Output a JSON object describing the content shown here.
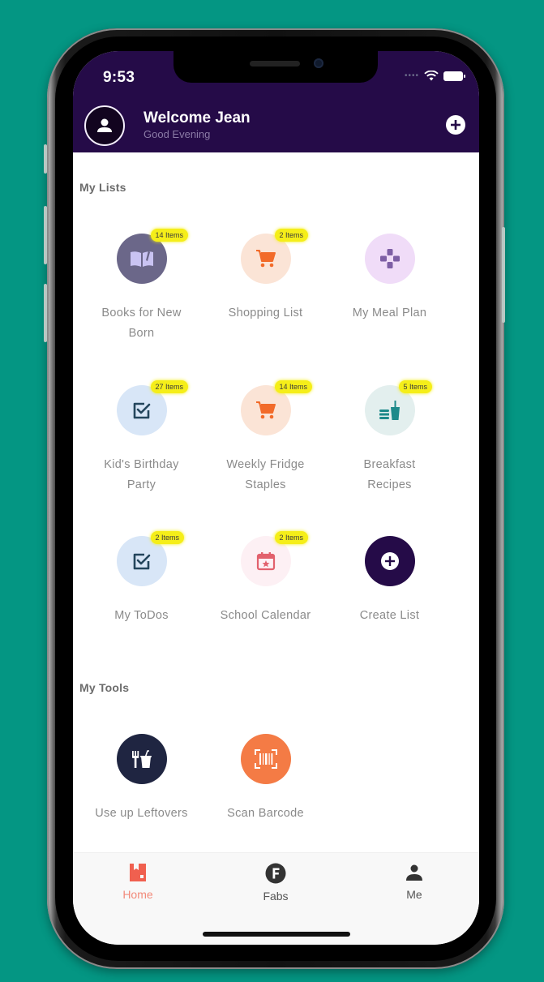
{
  "status_bar": {
    "time": "9:53",
    "signal_icon": "signal-dots-icon",
    "wifi_icon": "wifi-icon",
    "battery_icon": "battery-icon"
  },
  "header": {
    "avatar_icon": "user-icon",
    "title": "Welcome Jean",
    "subtitle": "Good Evening",
    "add_icon": "plus-circle-icon",
    "background": "#250b48"
  },
  "my_lists": {
    "title": "My Lists",
    "items": [
      {
        "label": "Books for New Born",
        "badge": "14 Items",
        "icon": "open-book-icon",
        "bg": "#6b6789",
        "fg": "#c9c3f2"
      },
      {
        "label": "Shopping List",
        "badge": "2 Items",
        "icon": "shopping-cart-icon",
        "bg": "#fbe4d6",
        "fg": "#f26b2a"
      },
      {
        "label": "My Meal Plan",
        "badge": "",
        "icon": "meal-plan-icon",
        "bg": "#f0dcf8",
        "fg": "#7e5fa5"
      },
      {
        "label": "Kid's Birthday Party",
        "badge": "27 Items",
        "icon": "checkbox-icon",
        "bg": "#d8e6f7",
        "fg": "#24465d"
      },
      {
        "label": "Weekly Fridge Staples",
        "badge": "14 Items",
        "icon": "shopping-cart-icon",
        "bg": "#fbe4d6",
        "fg": "#f26b2a"
      },
      {
        "label": "Breakfast Recipes",
        "badge": "5 Items",
        "icon": "burger-drink-icon",
        "bg": "#e3efee",
        "fg": "#1d8a8a"
      },
      {
        "label": "My ToDos",
        "badge": "2 Items",
        "icon": "checkbox-icon",
        "bg": "#d8e6f7",
        "fg": "#24465d"
      },
      {
        "label": "School Calendar",
        "badge": "2 Items",
        "icon": "calendar-star-icon",
        "bg": "#fdf0f4",
        "fg": "#e2616d"
      },
      {
        "label": "Create List",
        "badge": "",
        "icon": "plus-circle-icon",
        "bg": "#250b48",
        "fg": "#ffffff"
      }
    ]
  },
  "my_tools": {
    "title": "My Tools",
    "items": [
      {
        "label": "Use up Leftovers",
        "icon": "fork-drink-icon",
        "bg": "#1f2541",
        "fg": "#ffffff"
      },
      {
        "label": "Scan Barcode",
        "icon": "barcode-scan-icon",
        "bg": "#f47b45",
        "fg": "#ffffff"
      }
    ]
  },
  "tab_bar": {
    "active_color": "#f0604f",
    "tabs": [
      {
        "label": "Home",
        "icon": "home-list-icon",
        "active": true
      },
      {
        "label": "Fabs",
        "icon": "fabs-f-icon",
        "active": false
      },
      {
        "label": "Me",
        "icon": "person-icon",
        "active": false
      }
    ]
  }
}
